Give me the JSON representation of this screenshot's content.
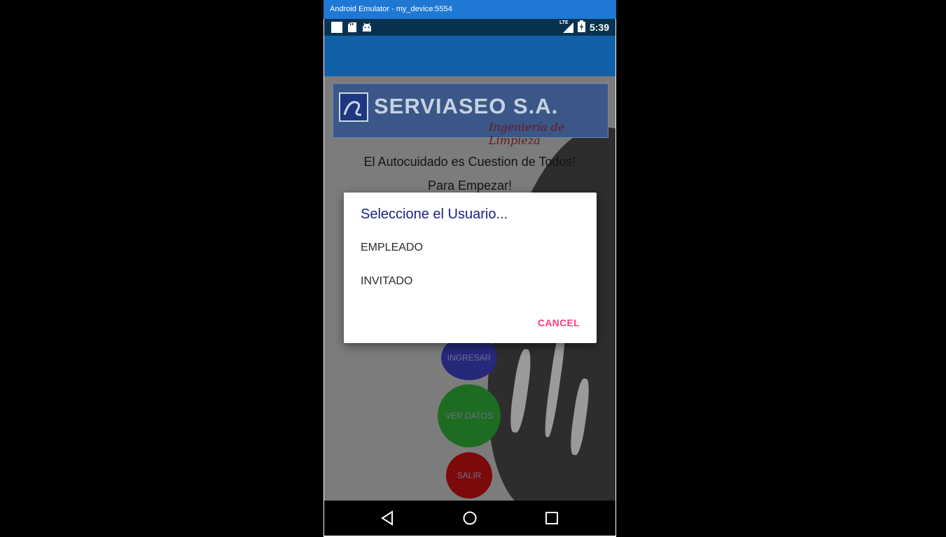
{
  "window": {
    "title": "Android Emulator - my_device:5554"
  },
  "status_bar": {
    "left_icons": [
      "square-icon",
      "sd-card-icon",
      "android-icon"
    ],
    "network": "LTE",
    "time": "5:39"
  },
  "brand": {
    "name": "SERVIASEO S.A.",
    "tagline": "Ingeniería de Limpieza"
  },
  "main": {
    "slogan": "El Autocuidado es Cuestion de Todos!",
    "subtitle": "Para Empezar!",
    "buttons": {
      "ingresar": "INGRESAR",
      "ver_datos": "VER DATOS",
      "salir": "SALIR"
    }
  },
  "dialog": {
    "title": "Seleccione el Usuario...",
    "options": [
      "EMPLEADO",
      "INVITADO"
    ],
    "cancel": "CANCEL"
  },
  "colors": {
    "title_bar": "#1e78d4",
    "app_bar": "#1261a6",
    "dialog_title": "#1c237e",
    "cancel_accent": "#ff3d7f"
  }
}
